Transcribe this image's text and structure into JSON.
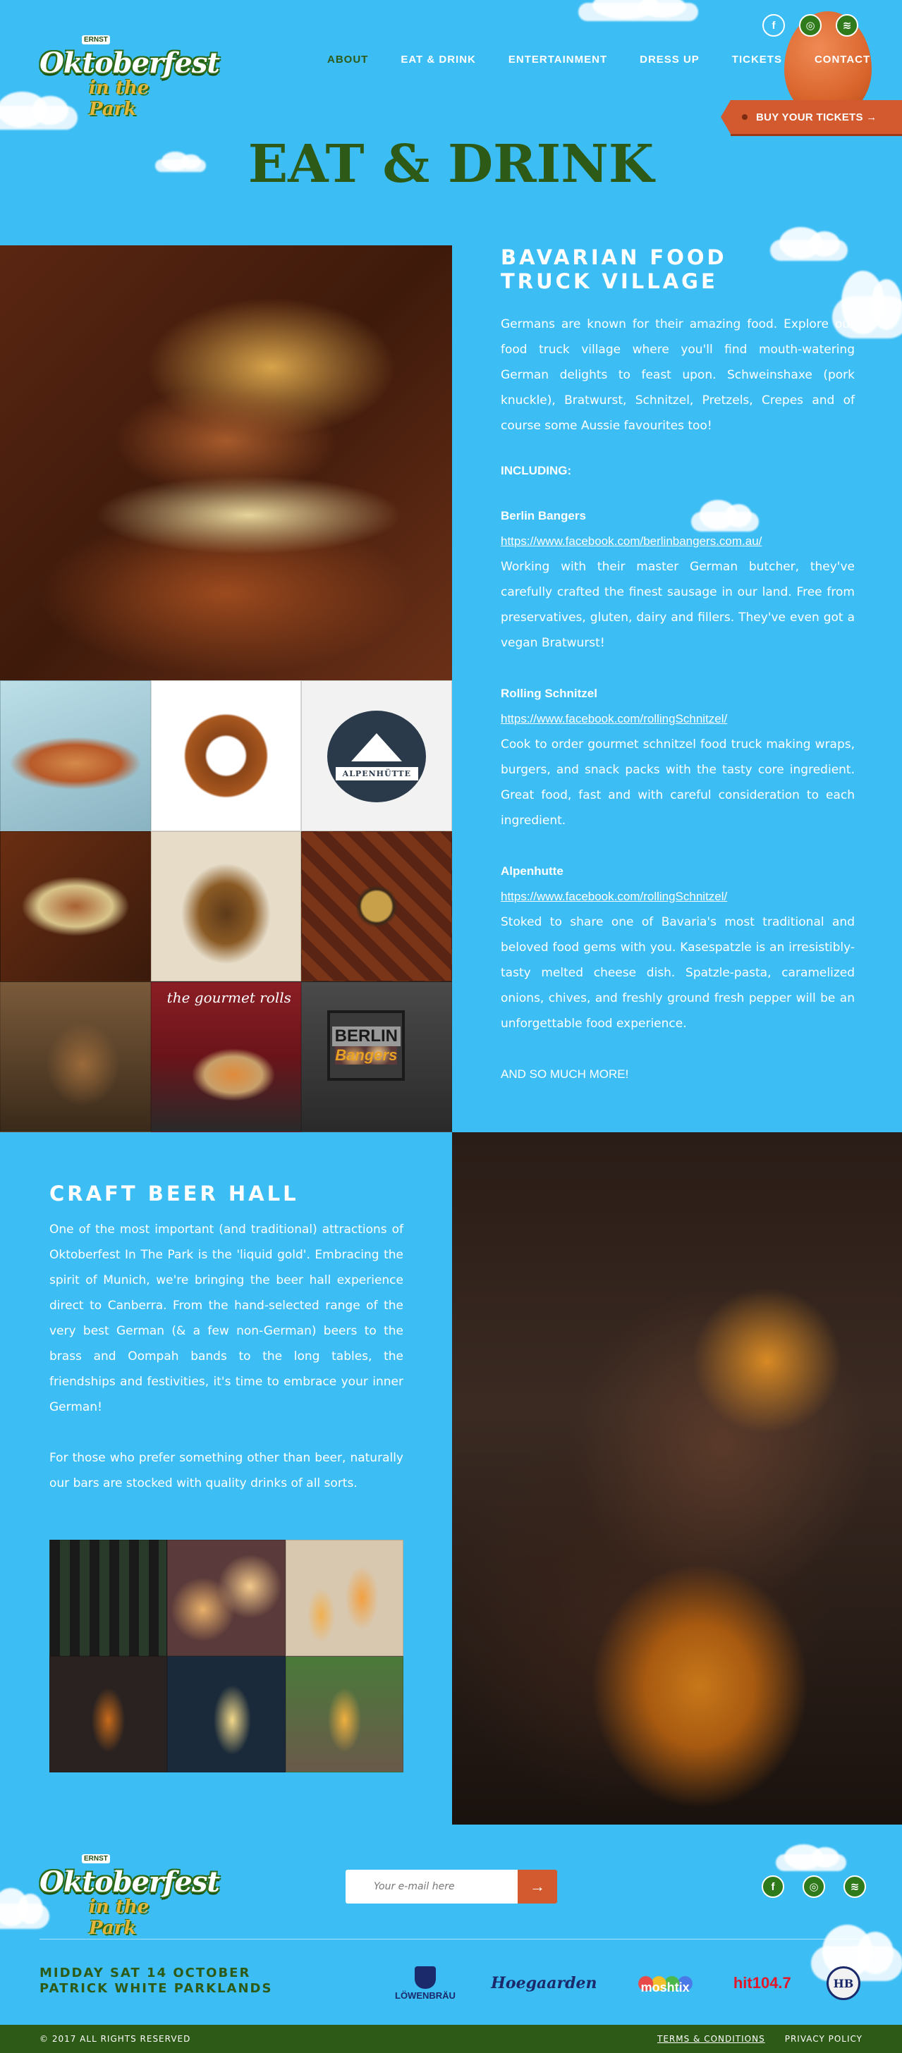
{
  "header": {
    "logo_top": "ERNST",
    "logo_main": "Oktoberfest",
    "logo_sub": "in the Park",
    "nav": [
      {
        "label": "About",
        "active": true
      },
      {
        "label": "Eat & Drink",
        "active": false
      },
      {
        "label": "Entertainment",
        "active": false
      },
      {
        "label": "Dress Up",
        "active": false
      },
      {
        "label": "Tickets",
        "active": false
      },
      {
        "label": "Contact",
        "active": false
      }
    ],
    "social": {
      "facebook": "f",
      "instagram": "◎",
      "spotify": "≋"
    },
    "buy_tickets": "BUY YOUR TICKETS →"
  },
  "page_title": "EAT & DRINK",
  "food": {
    "title_line1": "BAVARIAN FOOD",
    "title_line2": "TRUCK VILLAGE",
    "intro": "Germans are known for their amazing food. Explore our food truck village where you'll find mouth-watering German delights to feast upon. Schweinshaxe (pork knuckle), Bratwurst, Schnitzel, Pretzels, Crepes and of course some Aussie favourites too!",
    "including": "INCLUDING:",
    "vendors": [
      {
        "name": "Berlin Bangers",
        "link": "https://www.facebook.com/berlinbangers.com.au/",
        "description": "Working with their master German butcher, they've carefully crafted the finest sausage in our land. Free from preservatives, gluten, dairy and fillers. They've even got a vegan Bratwurst!"
      },
      {
        "name": "Rolling Schnitzel",
        "link": "https://www.facebook.com/rollingSchnitzel/",
        "description": "Cook to order gourmet schnitzel food truck making wraps, burgers, and snack packs with the tasty core ingredient. Great food, fast and with careful consideration to each ingredient."
      },
      {
        "name": "Alpenhutte",
        "link": "https://www.facebook.com/rollingSchnitzel/",
        "description": "Stoked to share one of Bavaria's most traditional and beloved food gems with you. Kasespatzle is an irresistibly-tasty melted cheese dish. Spatzle-pasta, caramelized onions, chives, and freshly ground fresh pepper will be an unforgettable food experience."
      }
    ],
    "more": "AND SO MUCH MORE!",
    "grid_labels": {
      "alpen_badge": "ALPENHÜTTE",
      "gourmet_tag": "the gourmet rolls",
      "berlin_top": "BERLIN",
      "berlin_bottom": "Bangers"
    }
  },
  "beer": {
    "title": "CRAFT BEER HALL",
    "paragraph1": "One of the most important (and traditional) attractions of Oktoberfest In The Park is the 'liquid gold'. Embracing the spirit of Munich, we're bringing the beer hall experience direct to Canberra. From the hand-selected range of the very best German (& a few non-German) beers to the brass and Oompah bands to the long tables, the friendships and festivities, it's time to embrace your inner German!",
    "paragraph2": "For those who prefer something other than beer, naturally our bars are stocked with quality drinks of all sorts."
  },
  "footer": {
    "email_placeholder": "Your e-mail here",
    "email_button": "→",
    "event_line1": "MIDDAY SAT 14 OCTOBER",
    "event_line2": "PATRICK WHITE PARKLANDS",
    "sponsors": {
      "lowenbrau": "LÖWENBRÄU",
      "hoegaarden": "Hoegaarden",
      "moshtix": "moshtix",
      "hit": "hit104.7",
      "hb": "HB"
    },
    "copyright": "© 2017 ALL RIGHTS RESERVED",
    "terms": "TERMS & CONDITIONS",
    "privacy": "PRIVACY POLICY"
  },
  "colors": {
    "sky": "#3cbdf4",
    "green": "#2d5a16",
    "orange": "#d25a2e"
  }
}
